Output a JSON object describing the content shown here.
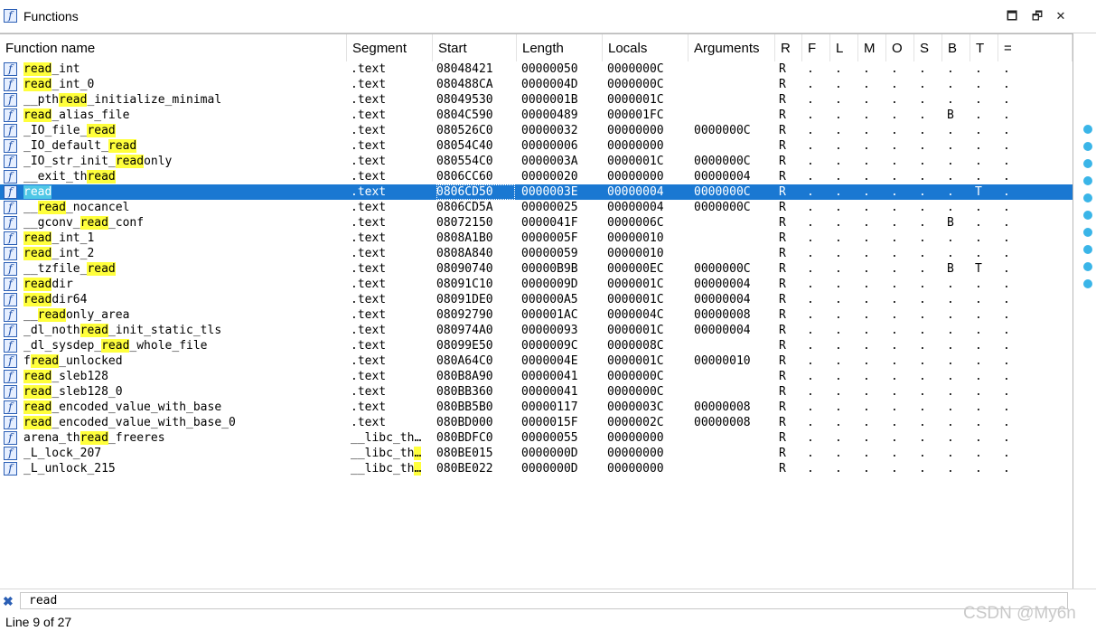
{
  "window": {
    "title": "Functions",
    "buttons": {
      "maximize": "🗖",
      "restore": "🗗",
      "close": "✕"
    }
  },
  "columns": [
    "Function name",
    "Segment",
    "Start",
    "Length",
    "Locals",
    "Arguments",
    "R",
    "F",
    "L",
    "M",
    "O",
    "S",
    "B",
    "T",
    "="
  ],
  "rows": [
    {
      "name": [
        [
          "read",
          1
        ],
        [
          "_int",
          0
        ]
      ],
      "seg": ".text",
      "start": "08048421",
      "len": "00000050",
      "loc": "0000000C",
      "args": "",
      "flags": [
        "R",
        ".",
        ".",
        ".",
        ".",
        ".",
        ".",
        ".",
        "."
      ]
    },
    {
      "name": [
        [
          "read",
          1
        ],
        [
          "_int_0",
          0
        ]
      ],
      "seg": ".text",
      "start": "080488CA",
      "len": "0000004D",
      "loc": "0000000C",
      "args": "",
      "flags": [
        "R",
        ".",
        ".",
        ".",
        ".",
        ".",
        ".",
        ".",
        "."
      ]
    },
    {
      "name": [
        [
          "__pth",
          0
        ],
        [
          "read",
          1
        ],
        [
          "_initialize_minimal",
          0
        ]
      ],
      "seg": ".text",
      "start": "08049530",
      "len": "0000001B",
      "loc": "0000001C",
      "args": "",
      "flags": [
        "R",
        ".",
        ".",
        ".",
        ".",
        ".",
        ".",
        ".",
        "."
      ]
    },
    {
      "name": [
        [
          "read",
          1
        ],
        [
          "_alias_file",
          0
        ]
      ],
      "seg": ".text",
      "start": "0804C590",
      "len": "00000489",
      "loc": "000001FC",
      "args": "",
      "flags": [
        "R",
        ".",
        ".",
        ".",
        ".",
        ".",
        "B",
        ".",
        "."
      ]
    },
    {
      "name": [
        [
          "_IO_file_",
          0
        ],
        [
          "read",
          1
        ]
      ],
      "seg": ".text",
      "start": "080526C0",
      "len": "00000032",
      "loc": "00000000",
      "args": "0000000C",
      "flags": [
        "R",
        ".",
        ".",
        ".",
        ".",
        ".",
        ".",
        ".",
        "."
      ]
    },
    {
      "name": [
        [
          "_IO_default_",
          0
        ],
        [
          "read",
          1
        ]
      ],
      "seg": ".text",
      "start": "08054C40",
      "len": "00000006",
      "loc": "00000000",
      "args": "",
      "flags": [
        "R",
        ".",
        ".",
        ".",
        ".",
        ".",
        ".",
        ".",
        "."
      ]
    },
    {
      "name": [
        [
          "_IO_str_init_",
          0
        ],
        [
          "read",
          1
        ],
        [
          "only",
          0
        ]
      ],
      "seg": ".text",
      "start": "080554C0",
      "len": "0000003A",
      "loc": "0000001C",
      "args": "0000000C",
      "flags": [
        "R",
        ".",
        ".",
        ".",
        ".",
        ".",
        ".",
        ".",
        "."
      ]
    },
    {
      "name": [
        [
          "__exit_th",
          0
        ],
        [
          "read",
          1
        ]
      ],
      "seg": ".text",
      "start": "0806CC60",
      "len": "00000020",
      "loc": "00000000",
      "args": "00000004",
      "flags": [
        "R",
        ".",
        ".",
        ".",
        ".",
        ".",
        ".",
        ".",
        "."
      ]
    },
    {
      "name": [
        [
          "read",
          1
        ]
      ],
      "seg": ".text",
      "start": "0806CD50",
      "len": "0000003E",
      "loc": "00000004",
      "args": "0000000C",
      "flags": [
        "R",
        ".",
        ".",
        ".",
        ".",
        ".",
        ".",
        "T",
        "."
      ],
      "selected": true
    },
    {
      "name": [
        [
          "__",
          0
        ],
        [
          "read",
          1
        ],
        [
          "_nocancel",
          0
        ]
      ],
      "seg": ".text",
      "start": "0806CD5A",
      "len": "00000025",
      "loc": "00000004",
      "args": "0000000C",
      "flags": [
        "R",
        ".",
        ".",
        ".",
        ".",
        ".",
        ".",
        ".",
        "."
      ]
    },
    {
      "name": [
        [
          "__gconv_",
          0
        ],
        [
          "read",
          1
        ],
        [
          "_conf",
          0
        ]
      ],
      "seg": ".text",
      "start": "08072150",
      "len": "0000041F",
      "loc": "0000006C",
      "args": "",
      "flags": [
        "R",
        ".",
        ".",
        ".",
        ".",
        ".",
        "B",
        ".",
        "."
      ]
    },
    {
      "name": [
        [
          "read",
          1
        ],
        [
          "_int_1",
          0
        ]
      ],
      "seg": ".text",
      "start": "0808A1B0",
      "len": "0000005F",
      "loc": "00000010",
      "args": "",
      "flags": [
        "R",
        ".",
        ".",
        ".",
        ".",
        ".",
        ".",
        ".",
        "."
      ]
    },
    {
      "name": [
        [
          "read",
          1
        ],
        [
          "_int_2",
          0
        ]
      ],
      "seg": ".text",
      "start": "0808A840",
      "len": "00000059",
      "loc": "00000010",
      "args": "",
      "flags": [
        "R",
        ".",
        ".",
        ".",
        ".",
        ".",
        ".",
        ".",
        "."
      ]
    },
    {
      "name": [
        [
          "__tzfile_",
          0
        ],
        [
          "read",
          1
        ]
      ],
      "seg": ".text",
      "start": "08090740",
      "len": "00000B9B",
      "loc": "000000EC",
      "args": "0000000C",
      "flags": [
        "R",
        ".",
        ".",
        ".",
        ".",
        ".",
        "B",
        "T",
        "."
      ]
    },
    {
      "name": [
        [
          "read",
          1
        ],
        [
          "dir",
          0
        ]
      ],
      "seg": ".text",
      "start": "08091C10",
      "len": "0000009D",
      "loc": "0000001C",
      "args": "00000004",
      "flags": [
        "R",
        ".",
        ".",
        ".",
        ".",
        ".",
        ".",
        ".",
        "."
      ]
    },
    {
      "name": [
        [
          "read",
          1
        ],
        [
          "dir64",
          0
        ]
      ],
      "seg": ".text",
      "start": "08091DE0",
      "len": "000000A5",
      "loc": "0000001C",
      "args": "00000004",
      "flags": [
        "R",
        ".",
        ".",
        ".",
        ".",
        ".",
        ".",
        ".",
        "."
      ]
    },
    {
      "name": [
        [
          "__",
          0
        ],
        [
          "read",
          1
        ],
        [
          "only_area",
          0
        ]
      ],
      "seg": ".text",
      "start": "08092790",
      "len": "000001AC",
      "loc": "0000004C",
      "args": "00000008",
      "flags": [
        "R",
        ".",
        ".",
        ".",
        ".",
        ".",
        ".",
        ".",
        "."
      ]
    },
    {
      "name": [
        [
          "_dl_noth",
          0
        ],
        [
          "read",
          1
        ],
        [
          "_init_static_tls",
          0
        ]
      ],
      "seg": ".text",
      "start": "080974A0",
      "len": "00000093",
      "loc": "0000001C",
      "args": "00000004",
      "flags": [
        "R",
        ".",
        ".",
        ".",
        ".",
        ".",
        ".",
        ".",
        "."
      ]
    },
    {
      "name": [
        [
          "_dl_sysdep_",
          0
        ],
        [
          "read",
          1
        ],
        [
          "_whole_file",
          0
        ]
      ],
      "seg": ".text",
      "start": "08099E50",
      "len": "0000009C",
      "loc": "0000008C",
      "args": "",
      "flags": [
        "R",
        ".",
        ".",
        ".",
        ".",
        ".",
        ".",
        ".",
        "."
      ]
    },
    {
      "name": [
        [
          "f",
          0
        ],
        [
          "read",
          1
        ],
        [
          "_unlocked",
          0
        ]
      ],
      "seg": ".text",
      "start": "080A64C0",
      "len": "0000004E",
      "loc": "0000001C",
      "args": "00000010",
      "flags": [
        "R",
        ".",
        ".",
        ".",
        ".",
        ".",
        ".",
        ".",
        "."
      ]
    },
    {
      "name": [
        [
          "read",
          1
        ],
        [
          "_sleb128",
          0
        ]
      ],
      "seg": ".text",
      "start": "080B8A90",
      "len": "00000041",
      "loc": "0000000C",
      "args": "",
      "flags": [
        "R",
        ".",
        ".",
        ".",
        ".",
        ".",
        ".",
        ".",
        "."
      ]
    },
    {
      "name": [
        [
          "read",
          1
        ],
        [
          "_sleb128_0",
          0
        ]
      ],
      "seg": ".text",
      "start": "080BB360",
      "len": "00000041",
      "loc": "0000000C",
      "args": "",
      "flags": [
        "R",
        ".",
        ".",
        ".",
        ".",
        ".",
        ".",
        ".",
        "."
      ]
    },
    {
      "name": [
        [
          "read",
          1
        ],
        [
          "_encoded_value_with_base",
          0
        ]
      ],
      "seg": ".text",
      "start": "080BB5B0",
      "len": "00000117",
      "loc": "0000003C",
      "args": "00000008",
      "flags": [
        "R",
        ".",
        ".",
        ".",
        ".",
        ".",
        ".",
        ".",
        "."
      ]
    },
    {
      "name": [
        [
          "read",
          1
        ],
        [
          "_encoded_value_with_base_0",
          0
        ]
      ],
      "seg": ".text",
      "start": "080BD000",
      "len": "0000015F",
      "loc": "0000002C",
      "args": "00000008",
      "flags": [
        "R",
        ".",
        ".",
        ".",
        ".",
        ".",
        ".",
        ".",
        "."
      ]
    },
    {
      "name": [
        [
          "arena_th",
          0
        ],
        [
          "read",
          1
        ],
        [
          "_freeres",
          0
        ]
      ],
      "seg": "__libc_th…",
      "start": "080BDFC0",
      "len": "00000055",
      "loc": "00000000",
      "args": "",
      "flags": [
        "R",
        ".",
        ".",
        ".",
        ".",
        ".",
        ".",
        ".",
        "."
      ]
    },
    {
      "name": [
        [
          "_L_lock_207",
          0
        ]
      ],
      "seg": "__libc_th…",
      "segEllHl": true,
      "start": "080BE015",
      "len": "0000000D",
      "loc": "00000000",
      "args": "",
      "flags": [
        "R",
        ".",
        ".",
        ".",
        ".",
        ".",
        ".",
        ".",
        "."
      ]
    },
    {
      "name": [
        [
          "_L_unlock_215",
          0
        ]
      ],
      "seg": "__libc_th…",
      "segEllHl": true,
      "start": "080BE022",
      "len": "0000000D",
      "loc": "00000000",
      "args": "",
      "flags": [
        "R",
        ".",
        ".",
        ".",
        ".",
        ".",
        ".",
        ".",
        "."
      ]
    }
  ],
  "search": {
    "value": "read"
  },
  "status": {
    "text": "Line 9 of 27"
  },
  "watermark": "CSDN @My6n",
  "colors": {
    "selection": "#1a78d2",
    "highlight": "#ffff3c",
    "accent": "#3ab5e8"
  }
}
